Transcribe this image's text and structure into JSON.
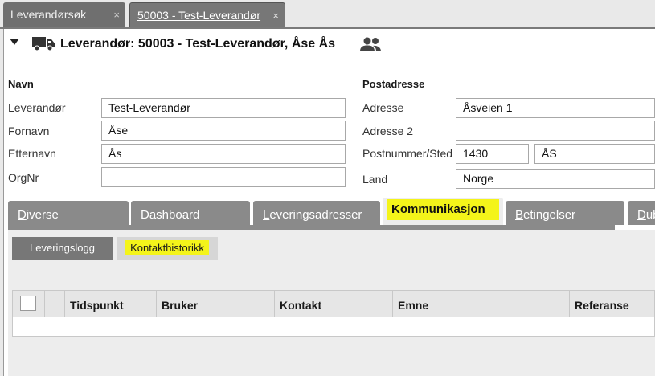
{
  "window_tabs": [
    {
      "label": "Leverandørsøk",
      "close": "×"
    },
    {
      "label": "50003 - Test-Leverandør",
      "close": "×"
    }
  ],
  "header": {
    "title": "Leverandør: 50003 - Test-Leverandør, Åse Ås",
    "collapse_icon": "caret-down-icon",
    "entity_icon": "truck-icon",
    "contacts_icon": "people-icon"
  },
  "name_section": {
    "heading": "Navn",
    "fields": [
      {
        "label": "Leverandør",
        "value": "Test-Leverandør"
      },
      {
        "label": "Fornavn",
        "value": "Åse"
      },
      {
        "label": "Etternavn",
        "value": "Ås"
      },
      {
        "label": "OrgNr",
        "value": ""
      }
    ]
  },
  "address_section": {
    "heading": "Postadresse",
    "fields": [
      {
        "label": "Adresse",
        "value": "Åsveien 1"
      },
      {
        "label": "Adresse 2",
        "value": ""
      },
      {
        "label": "Postnummer/Sted",
        "value": "1430",
        "value2": "ÅS"
      },
      {
        "label": "Land",
        "value": "Norge"
      }
    ]
  },
  "section_tabs": [
    {
      "label": "Diverse",
      "accel": "D",
      "rest": "iverse"
    },
    {
      "label": "Dashboard"
    },
    {
      "label": "Leveringsadresser",
      "accel": "L",
      "rest": "everingsadresser"
    },
    {
      "label": "Kommunikasjon",
      "active": true
    },
    {
      "label": "Betingelser",
      "accel": "B",
      "rest": "etingelser"
    },
    {
      "label": "Dub",
      "accel": "D",
      "rest": "ub"
    }
  ],
  "sub_tabs": [
    {
      "label": "Leveringslogg"
    },
    {
      "label": "Kontakthistorikk",
      "active": true
    }
  ],
  "grid": {
    "columns": [
      "Tidspunkt",
      "Bruker",
      "Kontakt",
      "Emne",
      "Referanse"
    ],
    "rows": []
  },
  "colors": {
    "highlight": "#f4f41a",
    "tab_inactive": "#8a8a8a",
    "panel": "#ededed"
  }
}
